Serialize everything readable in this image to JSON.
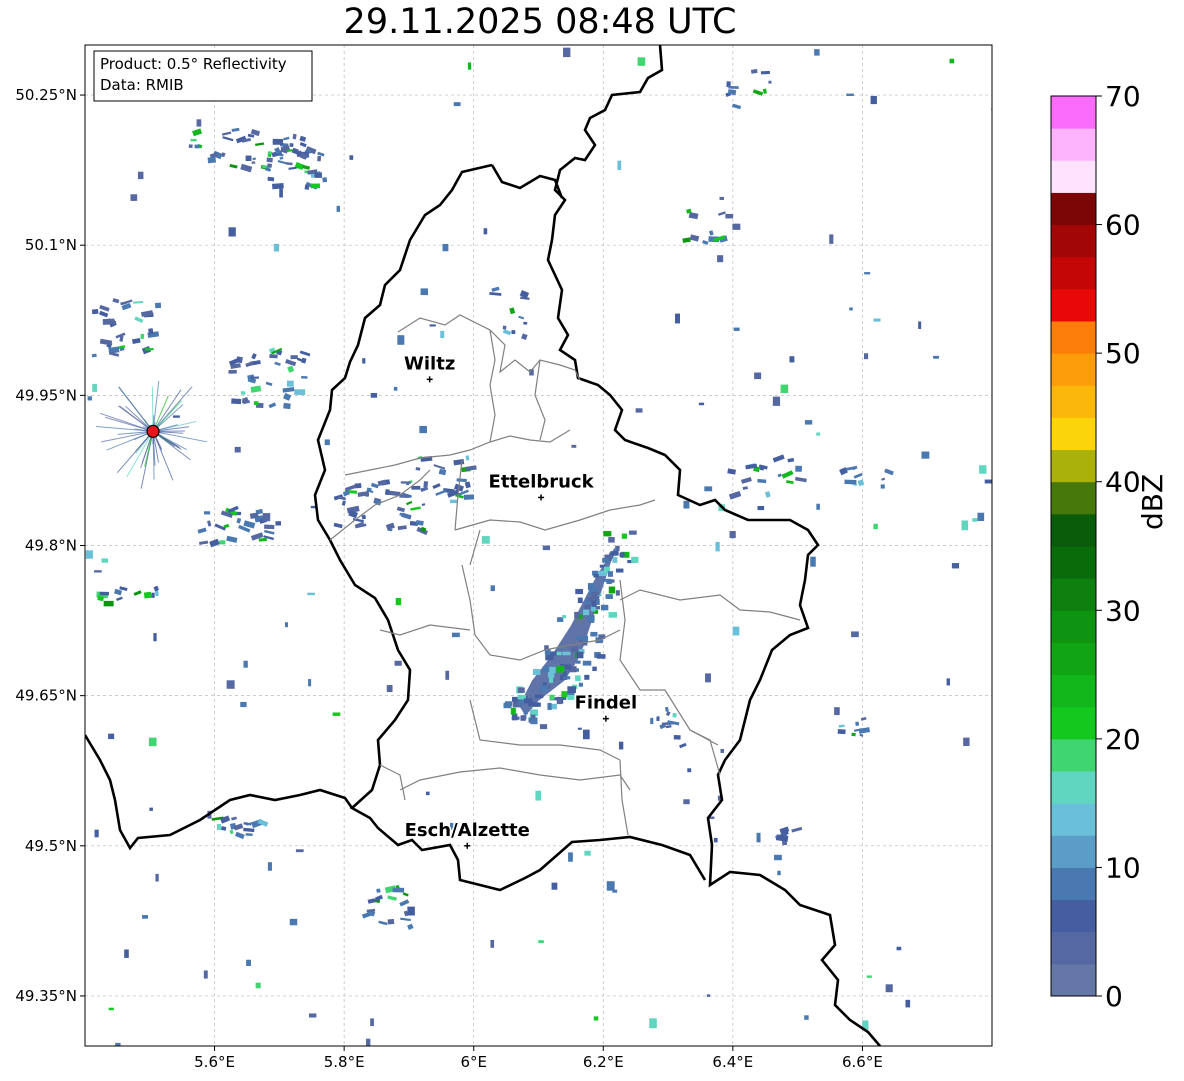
{
  "title": "29.11.2025 08:48 UTC",
  "info_box": {
    "product": "Product: 0.5° Reflectivity",
    "data": "Data: RMIB"
  },
  "axes": {
    "lon_min": 5.4,
    "lon_max": 6.8,
    "lat_min": 49.3,
    "lat_max": 50.3,
    "lat_ticks": [
      {
        "value": 50.25,
        "label": "50.25°N"
      },
      {
        "value": 50.1,
        "label": "50.1°N"
      },
      {
        "value": 49.95,
        "label": "49.95°N"
      },
      {
        "value": 49.8,
        "label": "49.8°N"
      },
      {
        "value": 49.65,
        "label": "49.65°N"
      },
      {
        "value": 49.5,
        "label": "49.5°N"
      },
      {
        "value": 49.35,
        "label": "49.35°N"
      }
    ],
    "lon_ticks": [
      {
        "value": 5.6,
        "label": "5.6°E"
      },
      {
        "value": 5.8,
        "label": "5.8°E"
      },
      {
        "value": 6.0,
        "label": "6°E"
      },
      {
        "value": 6.2,
        "label": "6.2°E"
      },
      {
        "value": 6.4,
        "label": "6.4°E"
      },
      {
        "value": 6.6,
        "label": "6.6°E"
      }
    ],
    "grid": true
  },
  "radar_site": {
    "lon": 5.505,
    "lat": 49.914,
    "color": "#e8161b"
  },
  "cities": [
    {
      "name": "Wiltz",
      "lon": 5.932,
      "lat": 49.966
    },
    {
      "name": "Ettelbruck",
      "lon": 6.104,
      "lat": 49.848
    },
    {
      "name": "Findel",
      "lon": 6.204,
      "lat": 49.627
    },
    {
      "name": "Esch/Alzette",
      "lon": 5.99,
      "lat": 49.5
    }
  ],
  "colorbar": {
    "label": "dBZ",
    "min": 0,
    "max": 70,
    "step": 2.5,
    "tick_labels": [
      "0",
      "10",
      "20",
      "30",
      "40",
      "50",
      "60",
      "70"
    ],
    "colors": [
      "#6577a7",
      "#5668a1",
      "#455ea0",
      "#4a78b0",
      "#5b9dc7",
      "#6ac0d8",
      "#60d6c0",
      "#3fd570",
      "#14c81e",
      "#12b81b",
      "#10a514",
      "#0e9410",
      "#0d800f",
      "#0a6b0b",
      "#0a5b0a",
      "#46780c",
      "#aab10a",
      "#fcd40a",
      "#fcb80a",
      "#fc9c0a",
      "#fc7e0a",
      "#e80808",
      "#c40606",
      "#a20606",
      "#7c0606",
      "#fee2fe",
      "#fdb4fd",
      "#fc6cfc",
      "#e63ce6"
    ]
  },
  "echo_main_band": [
    [
      6.22,
      49.8
    ],
    [
      6.21,
      49.78
    ],
    [
      6.2,
      49.76
    ],
    [
      6.19,
      49.74
    ],
    [
      6.18,
      49.72
    ],
    [
      6.17,
      49.7
    ],
    [
      6.16,
      49.685
    ],
    [
      6.14,
      49.665
    ],
    [
      6.12,
      49.655
    ],
    [
      6.1,
      49.645
    ],
    [
      6.08,
      49.63
    ],
    [
      6.07,
      49.64
    ],
    [
      6.09,
      49.665
    ],
    [
      6.12,
      49.69
    ],
    [
      6.15,
      49.72
    ],
    [
      6.17,
      49.745
    ],
    [
      6.19,
      49.77
    ]
  ],
  "echo_clusters": [
    {
      "lon": 5.65,
      "lat": 50.2,
      "n": 40,
      "dx": 0.09,
      "dy": 0.02
    },
    {
      "lon": 5.72,
      "lat": 50.18,
      "n": 25,
      "dx": 0.05,
      "dy": 0.02
    },
    {
      "lon": 5.46,
      "lat": 50.02,
      "n": 30,
      "dx": 0.05,
      "dy": 0.03
    },
    {
      "lon": 5.68,
      "lat": 49.97,
      "n": 35,
      "dx": 0.06,
      "dy": 0.03
    },
    {
      "lon": 5.85,
      "lat": 49.84,
      "n": 45,
      "dx": 0.07,
      "dy": 0.025
    },
    {
      "lon": 5.95,
      "lat": 49.87,
      "n": 20,
      "dx": 0.04,
      "dy": 0.02
    },
    {
      "lon": 5.62,
      "lat": 49.82,
      "n": 25,
      "dx": 0.06,
      "dy": 0.02
    },
    {
      "lon": 5.46,
      "lat": 49.75,
      "n": 12,
      "dx": 0.05,
      "dy": 0.01
    },
    {
      "lon": 5.85,
      "lat": 49.44,
      "n": 18,
      "dx": 0.05,
      "dy": 0.02
    },
    {
      "lon": 5.62,
      "lat": 49.52,
      "n": 14,
      "dx": 0.05,
      "dy": 0.01
    },
    {
      "lon": 6.3,
      "lat": 49.62,
      "n": 10,
      "dx": 0.02,
      "dy": 0.02
    },
    {
      "lon": 6.44,
      "lat": 49.87,
      "n": 18,
      "dx": 0.06,
      "dy": 0.02
    },
    {
      "lon": 6.6,
      "lat": 49.87,
      "n": 10,
      "dx": 0.04,
      "dy": 0.01
    },
    {
      "lon": 6.35,
      "lat": 50.12,
      "n": 10,
      "dx": 0.03,
      "dy": 0.02
    },
    {
      "lon": 6.42,
      "lat": 50.26,
      "n": 10,
      "dx": 0.04,
      "dy": 0.02
    },
    {
      "lon": 6.05,
      "lat": 50.03,
      "n": 10,
      "dx": 0.03,
      "dy": 0.03
    },
    {
      "lon": 6.58,
      "lat": 49.62,
      "n": 8,
      "dx": 0.02,
      "dy": 0.01
    },
    {
      "lon": 6.48,
      "lat": 49.51,
      "n": 6,
      "dx": 0.02,
      "dy": 0.01
    }
  ]
}
